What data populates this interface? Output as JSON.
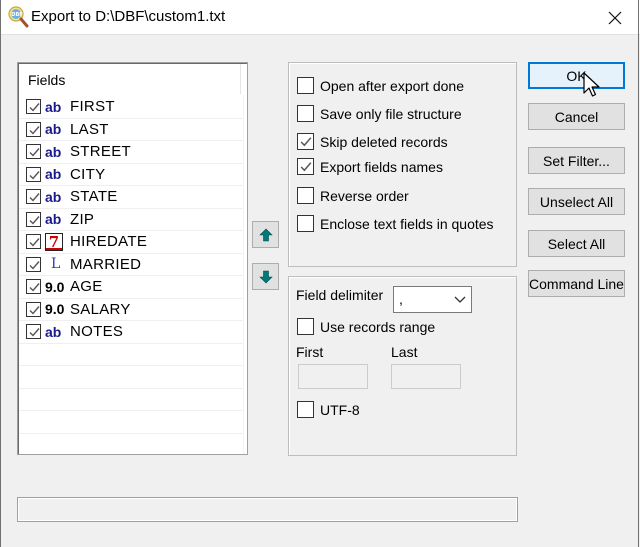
{
  "window": {
    "title": "Export to D:\\DBF\\custom1.txt",
    "app_icon": "dbf-magnifier-icon",
    "close_icon": "close-icon"
  },
  "fields_list": {
    "header": "Fields",
    "items": [
      {
        "name": "FIRST",
        "type": "character",
        "type_label": "ab",
        "checked": true
      },
      {
        "name": "LAST",
        "type": "character",
        "type_label": "ab",
        "checked": true
      },
      {
        "name": "STREET",
        "type": "character",
        "type_label": "ab",
        "checked": true
      },
      {
        "name": "CITY",
        "type": "character",
        "type_label": "ab",
        "checked": true
      },
      {
        "name": "STATE",
        "type": "character",
        "type_label": "ab",
        "checked": true
      },
      {
        "name": "ZIP",
        "type": "character",
        "type_label": "ab",
        "checked": true
      },
      {
        "name": "HIREDATE",
        "type": "date",
        "type_label": "7",
        "checked": true
      },
      {
        "name": "MARRIED",
        "type": "logical",
        "type_label": "L",
        "checked": true
      },
      {
        "name": "AGE",
        "type": "numeric",
        "type_label": "9.0",
        "checked": true
      },
      {
        "name": "SALARY",
        "type": "numeric",
        "type_label": "9.0",
        "checked": true
      },
      {
        "name": "NOTES",
        "type": "memo",
        "type_label": "ab",
        "checked": true
      }
    ]
  },
  "move_buttons": {
    "up_icon": "arrow-up-icon",
    "down_icon": "arrow-down-icon"
  },
  "options": [
    {
      "label": "Open after export done",
      "checked": false
    },
    {
      "label": "Save only file structure",
      "checked": false
    },
    {
      "label": "Skip deleted records",
      "checked": true
    },
    {
      "label": "Export fields names",
      "checked": true
    },
    {
      "label": "Reverse order",
      "checked": false
    },
    {
      "label": "Enclose text fields in quotes",
      "checked": false
    }
  ],
  "format": {
    "delimiter_label": "Field delimiter",
    "delimiter_value": ",",
    "use_range_label": "Use records range",
    "use_range_checked": false,
    "first_label": "First",
    "first_value": "",
    "last_label": "Last",
    "last_value": "",
    "utf8_label": "UTF-8",
    "utf8_checked": false
  },
  "buttons": {
    "ok": "OK",
    "cancel": "Cancel",
    "set_filter": "Set Filter...",
    "unselect_all": "Unselect All",
    "select_all": "Select All",
    "command_line": "Command Line"
  },
  "progress": {
    "value": 0
  },
  "colors": {
    "default_button_border": "#0078d7",
    "default_button_bg": "#e5f1fb",
    "arrow_teal": "#007a7a",
    "type_char_color": "#1a1a8c",
    "date_icon_red": "#cc0000",
    "logical_blue": "#3333cc"
  }
}
